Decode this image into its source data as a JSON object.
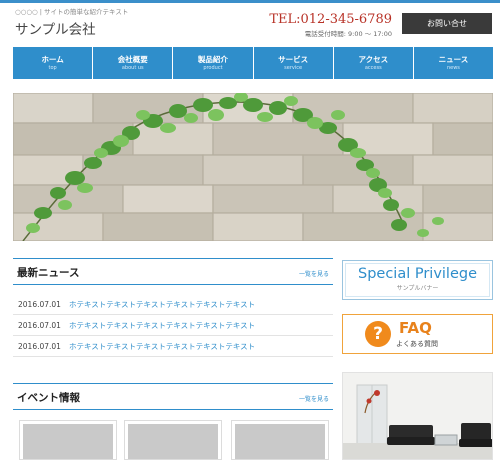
{
  "header": {
    "tagline": "○○○○ | サイトの簡単な紹介テキスト",
    "site_name": "サンプル会社",
    "tel": "TEL:012-345-6789",
    "hours": "電話受付時間: 9:00 〜 17:00",
    "contact_label": "お問い合せ"
  },
  "nav": [
    {
      "label": "ホーム",
      "sub": "top"
    },
    {
      "label": "会社概要",
      "sub": "about us"
    },
    {
      "label": "製品紹介",
      "sub": "product"
    },
    {
      "label": "サービス",
      "sub": "service"
    },
    {
      "label": "アクセス",
      "sub": "access"
    },
    {
      "label": "ニュース",
      "sub": "news"
    }
  ],
  "news": {
    "title": "最新ニュース",
    "see_all": "一覧を見る",
    "items": [
      {
        "date": "2016.07.01",
        "text": "ホテキストテキストテキストテキストテキストテキスト"
      },
      {
        "date": "2016.07.01",
        "text": "ホテキストテキストテキストテキストテキストテキスト"
      },
      {
        "date": "2016.07.01",
        "text": "ホテキストテキストテキストテキストテキストテキスト"
      }
    ]
  },
  "events": {
    "title": "イベント情報",
    "see_all": "一覧を見る"
  },
  "sidebar": {
    "special_title": "Special Privilege",
    "special_sub": "サンプルバナー",
    "faq_icon": "?",
    "faq_title": "FAQ",
    "faq_sub": "よくある質問"
  },
  "colors": {
    "accent": "#2f8ecb",
    "tel": "#b83227",
    "faq": "#f08a1c",
    "dark_button": "#3a3a3a"
  }
}
